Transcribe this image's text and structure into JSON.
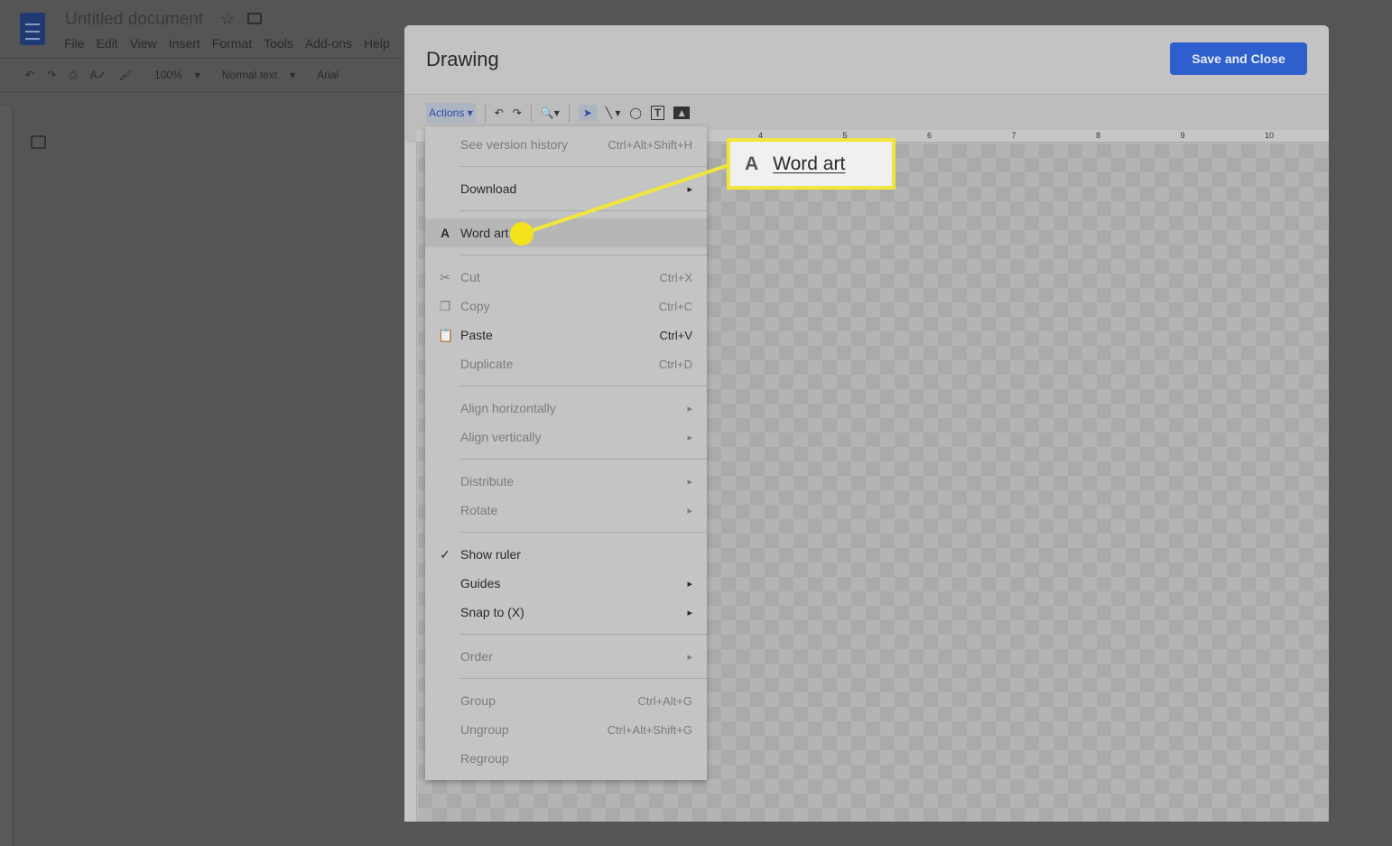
{
  "docs": {
    "title": "Untitled document",
    "menus": [
      "File",
      "Edit",
      "View",
      "Insert",
      "Format",
      "Tools",
      "Add-ons",
      "Help"
    ],
    "toolbar": {
      "zoom": "100%",
      "style": "Normal text",
      "font": "Arial"
    }
  },
  "dialog": {
    "title": "Drawing",
    "save_label": "Save and Close",
    "actions_label": "Actions",
    "ruler_ticks": [
      "4",
      "5",
      "6",
      "7",
      "8",
      "9",
      "10"
    ]
  },
  "menu": {
    "items": [
      {
        "label": "See version history",
        "shortcut": "Ctrl+Alt+Shift+H",
        "enabled": false
      },
      {
        "sep": true
      },
      {
        "label": "Download",
        "submenu": true,
        "enabled": true
      },
      {
        "sep": true
      },
      {
        "label": "Word art",
        "icon": "word-art-icon",
        "enabled": true,
        "highlighted": true
      },
      {
        "sep": true
      },
      {
        "label": "Cut",
        "shortcut": "Ctrl+X",
        "icon": "scissors-icon",
        "enabled": false
      },
      {
        "label": "Copy",
        "shortcut": "Ctrl+C",
        "icon": "copy-icon",
        "enabled": false
      },
      {
        "label": "Paste",
        "shortcut": "Ctrl+V",
        "icon": "clipboard-icon",
        "enabled": true
      },
      {
        "label": "Duplicate",
        "shortcut": "Ctrl+D",
        "enabled": false
      },
      {
        "sep": true
      },
      {
        "label": "Align horizontally",
        "submenu": true,
        "enabled": false
      },
      {
        "label": "Align vertically",
        "submenu": true,
        "enabled": false
      },
      {
        "sep": true
      },
      {
        "label": "Distribute",
        "submenu": true,
        "enabled": false
      },
      {
        "label": "Rotate",
        "submenu": true,
        "enabled": false
      },
      {
        "sep": true
      },
      {
        "label": "Show ruler",
        "icon": "check-icon",
        "checked": true,
        "enabled": true
      },
      {
        "label": "Guides",
        "submenu": true,
        "enabled": true
      },
      {
        "label": "Snap to (X)",
        "submenu": true,
        "enabled": true
      },
      {
        "sep": true
      },
      {
        "label": "Order",
        "submenu": true,
        "enabled": false
      },
      {
        "sep": true
      },
      {
        "label": "Group",
        "shortcut": "Ctrl+Alt+G",
        "enabled": false
      },
      {
        "label": "Ungroup",
        "shortcut": "Ctrl+Alt+Shift+G",
        "enabled": false
      },
      {
        "label": "Regroup",
        "enabled": false
      }
    ]
  },
  "callout": {
    "label": "Word art",
    "color": "#f3e63a"
  },
  "colors": {
    "accent": "#2f5fcd"
  }
}
